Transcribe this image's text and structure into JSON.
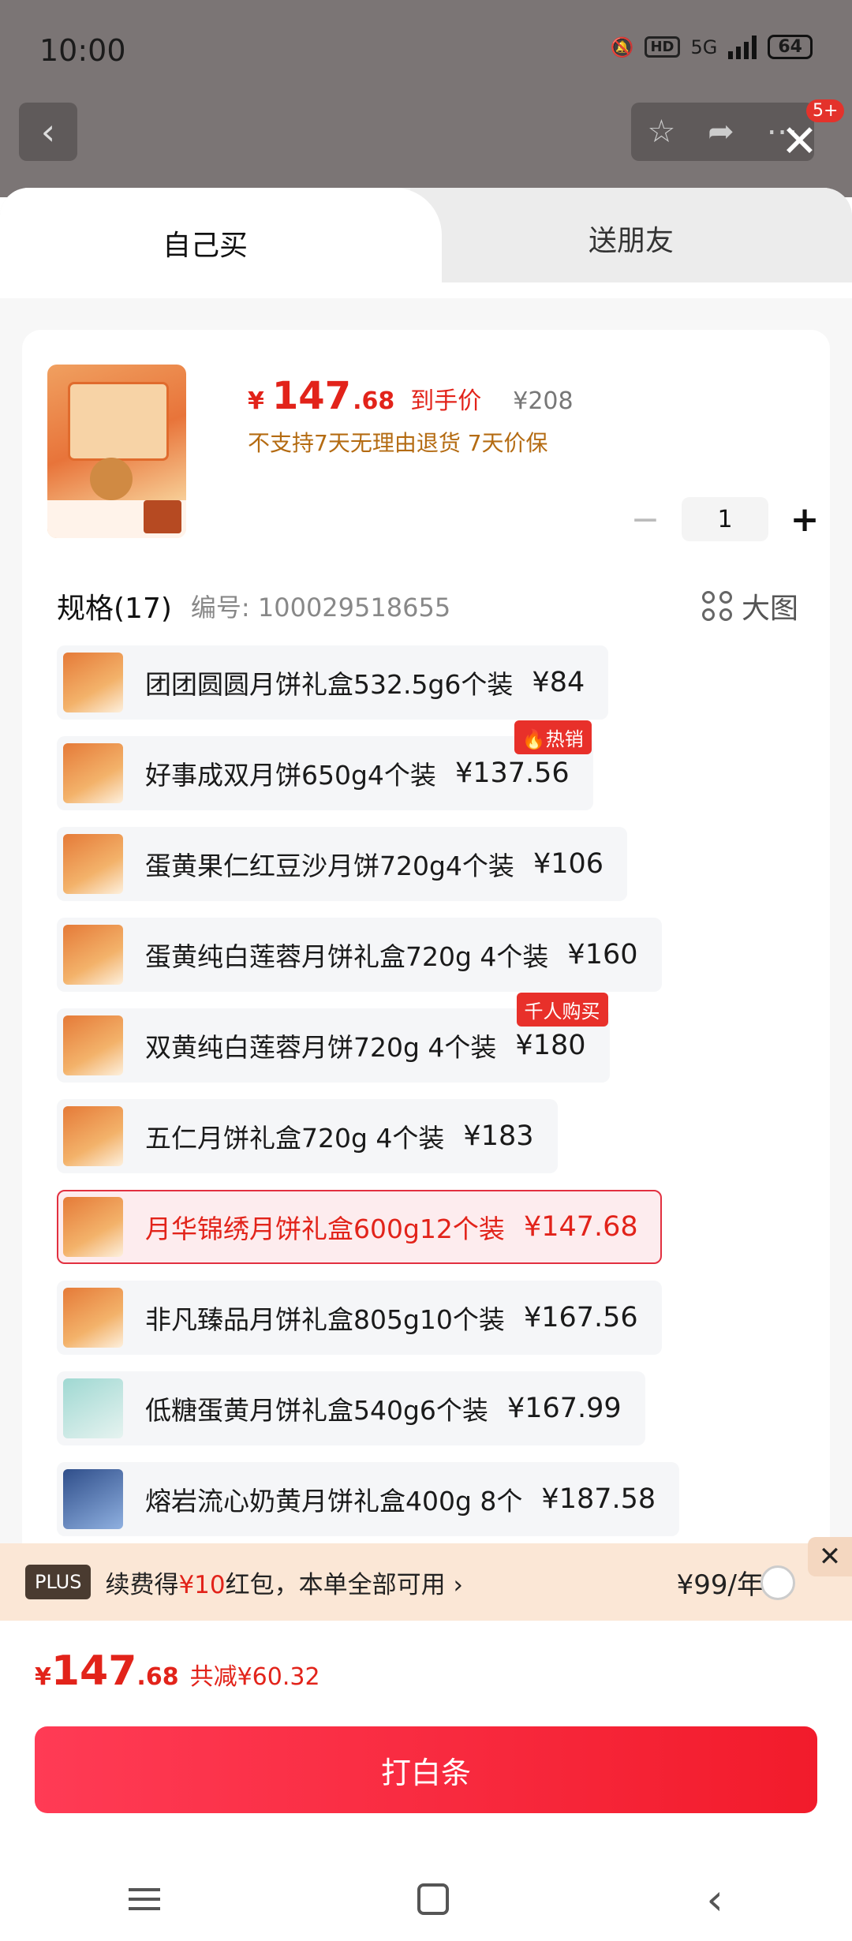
{
  "status_bar": {
    "time": "10:00",
    "hd": "HD",
    "network": "5G",
    "battery": "64"
  },
  "topbar": {
    "back_icon": "chevron-left-icon",
    "badge": "5+"
  },
  "tabs": [
    {
      "label": "自己买"
    },
    {
      "label": "送朋友"
    }
  ],
  "product": {
    "price_symbol": "¥",
    "price_int": "147",
    "price_dec": ".68",
    "price_label": "到手价",
    "original_price": "¥208",
    "policy": "不支持7天无理由退货  7天价保",
    "quantity": "1"
  },
  "spec": {
    "title": "规格(17)",
    "sku": "编号: 100029518655",
    "big_view": "大图",
    "items": [
      {
        "name": "团团圆圆月饼礼盒532.5g6个装",
        "price": "¥84",
        "flag": ""
      },
      {
        "name": "好事成双月饼650g4个装",
        "price": "¥137.56",
        "flag": "🔥热销"
      },
      {
        "name": "蛋黄果仁红豆沙月饼720g4个装",
        "price": "¥106",
        "flag": ""
      },
      {
        "name": "蛋黄纯白莲蓉月饼礼盒720g 4个装",
        "price": "¥160",
        "flag": ""
      },
      {
        "name": "双黄纯白莲蓉月饼720g 4个装",
        "price": "¥180",
        "flag": "千人购买"
      },
      {
        "name": "五仁月饼礼盒720g 4个装",
        "price": "¥183",
        "flag": ""
      },
      {
        "name": "月华锦绣月饼礼盒600g12个装",
        "price": "¥147.68",
        "flag": "",
        "selected": true
      },
      {
        "name": "非凡臻品月饼礼盒805g10个装",
        "price": "¥167.56",
        "flag": ""
      },
      {
        "name": "低糖蛋黄月饼礼盒540g6个装",
        "price": "¥167.99",
        "flag": ""
      },
      {
        "name": "熔岩流心奶黄月饼礼盒400g 8个",
        "price": "¥187.58",
        "flag": ""
      }
    ]
  },
  "plus": {
    "tag": "PLUS",
    "text_before": "续费得",
    "text_highlight": "¥10",
    "text_after": "红包，本单全部可用 ›",
    "price": "¥99/年"
  },
  "footer": {
    "price_symbol": "¥",
    "price_int": "147",
    "price_dec": ".68",
    "saving": "共减¥60.32",
    "button": "打白条"
  },
  "colors": {
    "accent": "#e2231a",
    "button": "#f21b2b",
    "plus_bg": "#fbe7d6"
  }
}
